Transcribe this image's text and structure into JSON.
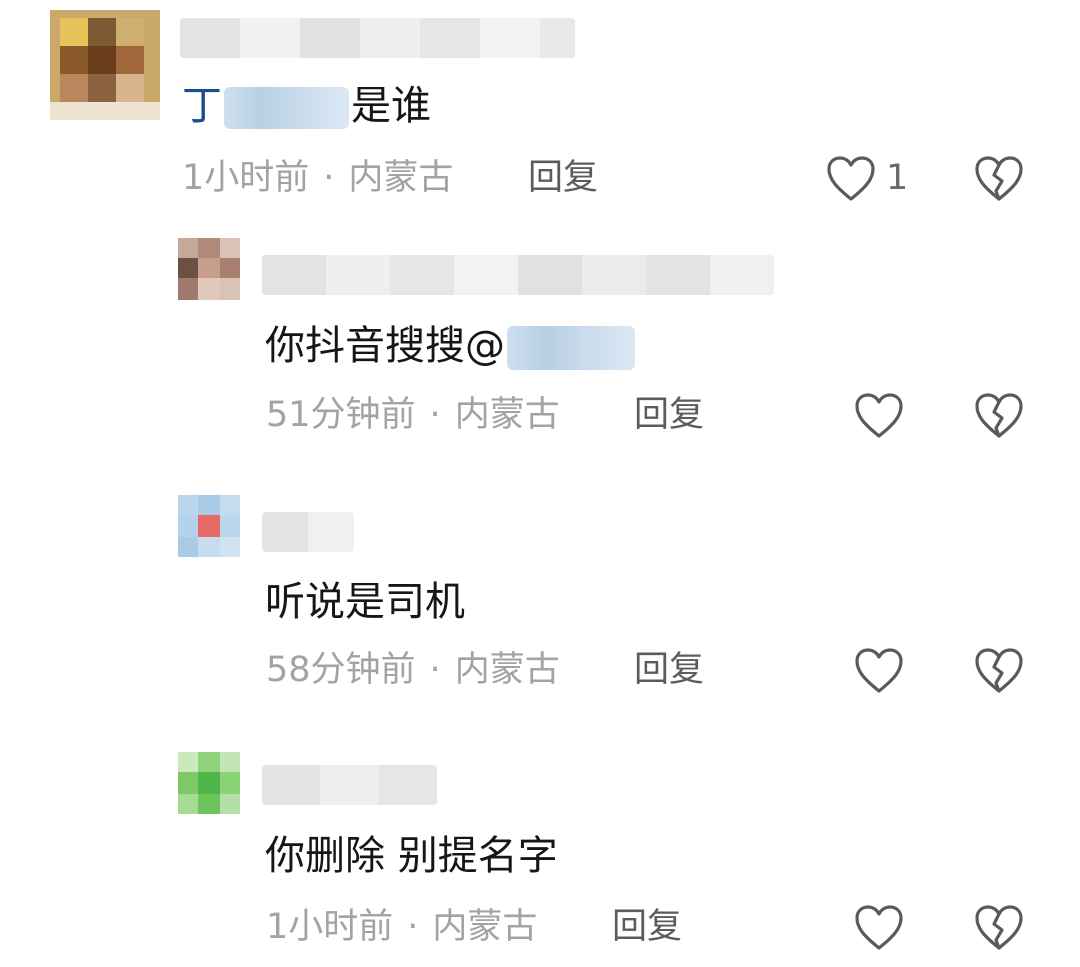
{
  "comments": [
    {
      "text_prefix": "丁",
      "text_suffix": "是谁",
      "time": "1小时前",
      "sep": "·",
      "location": "内蒙古",
      "reply_label": "回复",
      "like_count": "1"
    },
    {
      "text_prefix": "你抖音搜搜@",
      "time": "51分钟前",
      "sep": "·",
      "location": "内蒙古",
      "reply_label": "回复"
    },
    {
      "text": "听说是司机",
      "time": "58分钟前",
      "sep": "·",
      "location": "内蒙古",
      "reply_label": "回复"
    },
    {
      "text": "你删除 别提名字",
      "time": "1小时前",
      "sep": "·",
      "location": "内蒙古",
      "reply_label": "回复"
    }
  ],
  "icons": {
    "like": "heart-outline-icon",
    "dislike": "broken-heart-icon"
  },
  "colors": {
    "text": "#161616",
    "meta": "#a3a3a3",
    "reply": "#5c5c5c",
    "mention": "#1f4b8f"
  }
}
